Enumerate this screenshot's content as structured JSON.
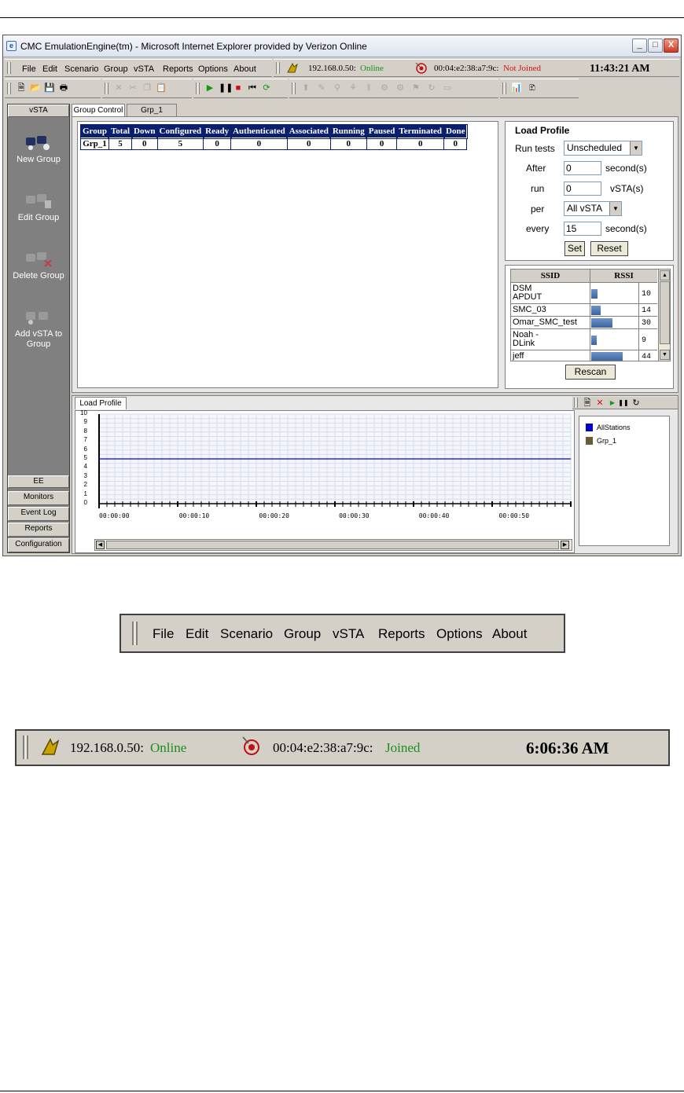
{
  "window": {
    "title": "CMC EmulationEngine(tm) - Microsoft Internet Explorer provided by Verizon Online",
    "controls": [
      "_",
      "□",
      "X"
    ]
  },
  "menu": [
    "File",
    "Edit",
    "Scenario",
    "Group",
    "vSTA",
    "Reports",
    "Options",
    "About"
  ],
  "status": {
    "ip": "192.168.0.50:",
    "ip_state": "Online",
    "mac": "00:04:e2:38:a7:9c:",
    "mac_state": "Not Joined",
    "time": "11:43:21 AM"
  },
  "colors": {
    "online": "#1a8f1a",
    "not_joined": "#d01010",
    "table_header": "#0a1f6e",
    "rssi_bar": "#4a6fae"
  },
  "nav": {
    "header": "vSTA",
    "items": [
      "New Group",
      "Edit Group",
      "Delete Group",
      "Add vSTA to Group"
    ],
    "bottom": [
      "EE",
      "Monitors",
      "Event Log",
      "Reports",
      "Configuration"
    ]
  },
  "tabs": [
    "Group Control",
    "Grp_1"
  ],
  "group_table": {
    "headers": [
      "Group",
      "Total",
      "Down",
      "Configured",
      "Ready",
      "Authenticated",
      "Associated",
      "Running",
      "Paused",
      "Terminated",
      "Done"
    ],
    "rows": [
      [
        "Grp_1",
        "5",
        "0",
        "5",
        "0",
        "0",
        "0",
        "0",
        "0",
        "0",
        "0"
      ]
    ]
  },
  "load_profile": {
    "title": "Load Profile",
    "run_tests_label": "Run tests",
    "run_tests_value": "Unscheduled",
    "after_label": "After",
    "after_value": "0",
    "after_unit": "second(s)",
    "run_label": "run",
    "run_value": "0",
    "run_unit": "vSTA(s)",
    "per_label": "per",
    "per_value": "All vSTA",
    "every_label": "every",
    "every_value": "15",
    "every_unit": "second(s)",
    "set": "Set",
    "reset": "Reset"
  },
  "ssid": {
    "headers": [
      "SSID",
      "RSSI"
    ],
    "rows": [
      {
        "name": "DSM APDUT",
        "rssi": "10"
      },
      {
        "name": "SMC_03",
        "rssi": "14"
      },
      {
        "name": "Omar_SMC_test",
        "rssi": "30"
      },
      {
        "name": "Noah - DLink",
        "rssi": "9"
      },
      {
        "name": "jeff",
        "rssi": "44"
      }
    ],
    "rescan": "Rescan"
  },
  "chart_tab": "Load Profile",
  "chart_data": {
    "type": "line",
    "x_ticks": [
      "00:00:00",
      "00:00:10",
      "00:00:20",
      "00:00:30",
      "00:00:40",
      "00:00:50"
    ],
    "y_ticks": [
      "10",
      "9",
      "8",
      "7",
      "6",
      "5",
      "4",
      "3",
      "2",
      "1",
      "0"
    ],
    "ylim": [
      0,
      10
    ],
    "grid": true,
    "legend_position": "right",
    "series": [
      {
        "name": "AllStations",
        "color": "#0000cc",
        "values": [
          5,
          5,
          5,
          5,
          5,
          5
        ]
      },
      {
        "name": "Grp_1",
        "color": "#6b5a3a",
        "values": []
      }
    ]
  },
  "menu_crop": [
    "File",
    "Edit",
    "Scenario",
    "Group",
    "vSTA",
    "Reports",
    "Options",
    "About"
  ],
  "status_crop": {
    "ip": "192.168.0.50:",
    "ip_state": "Online",
    "mac": "00:04:e2:38:a7:9c:",
    "mac_state": "Joined",
    "time": "6:06:36 AM"
  }
}
